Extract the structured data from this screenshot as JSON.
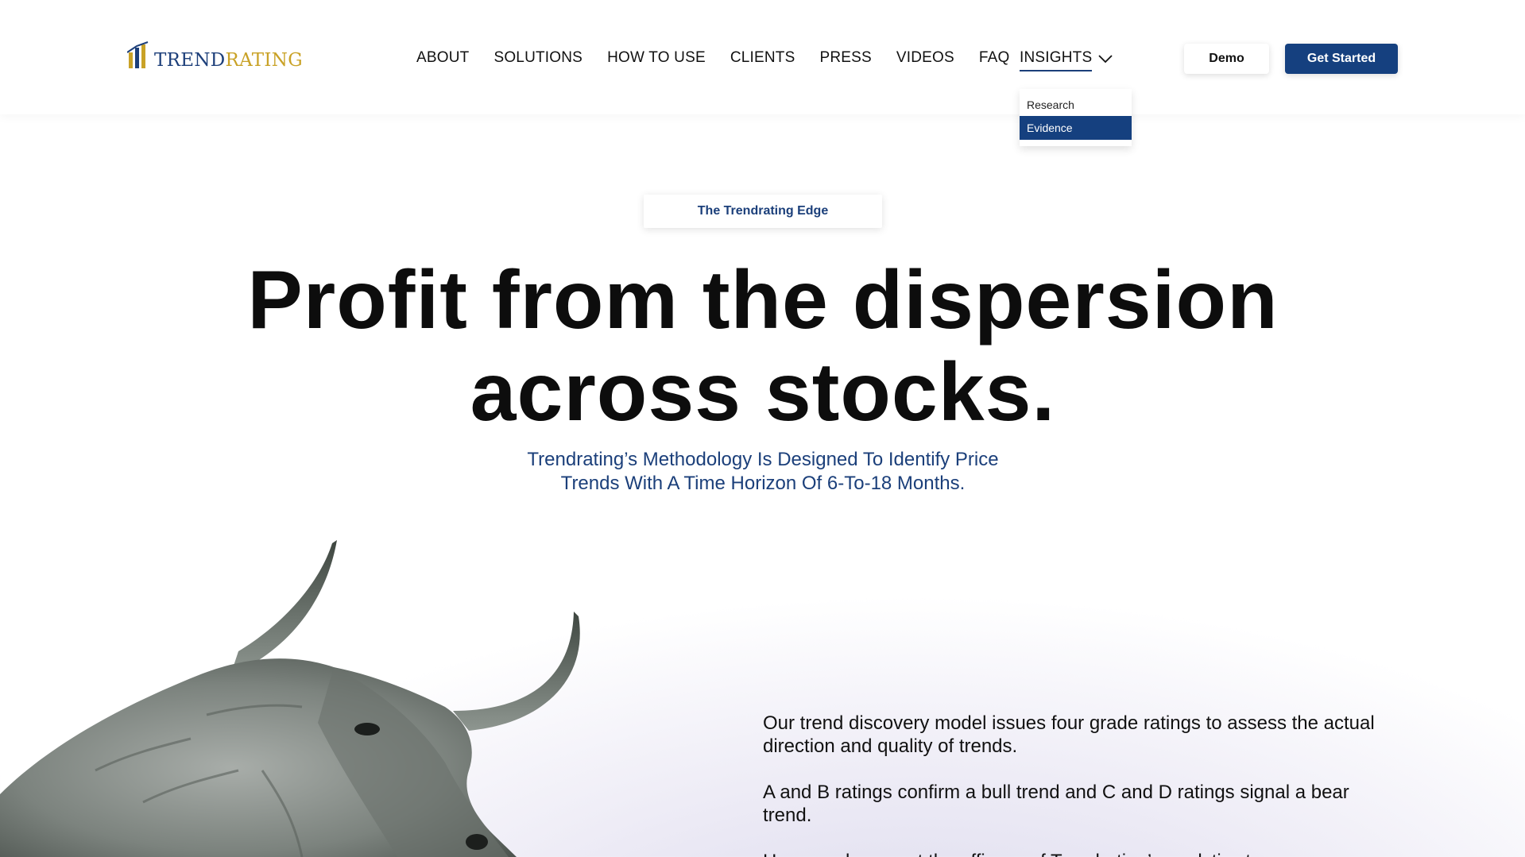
{
  "header": {
    "logo": {
      "trend": "TREND",
      "rating": "RATING"
    },
    "nav": [
      {
        "label": "ABOUT"
      },
      {
        "label": "SOLUTIONS"
      },
      {
        "label": "HOW TO USE"
      },
      {
        "label": "CLIENTS"
      },
      {
        "label": "PRESS"
      },
      {
        "label": "VIDEOS"
      },
      {
        "label": "FAQ"
      }
    ],
    "insights": {
      "label": "INSIGHTS",
      "icon": "chevron-down-icon"
    },
    "demo_label": "Demo",
    "get_started_label": "Get Started"
  },
  "dropdown": {
    "items": [
      {
        "label": "Research",
        "active": false
      },
      {
        "label": "Evidence",
        "active": true
      }
    ]
  },
  "hero": {
    "badge": "The Trendrating Edge",
    "headline_line1": "Profit from the dispersion",
    "headline_line2": "across stocks.",
    "subhead_line1": "Trendrating’s Methodology Is Designed To Identify Price",
    "subhead_line2": "Trends With A Time Horizon Of 6-To-18 Months."
  },
  "content": {
    "paragraphs": [
      "Our trend discovery model issues four grade ratings to assess the actual direction and quality of trends.",
      "A and B ratings confirm a bull trend and C and D ratings signal a bear trend.",
      "Here we document the efficacy of Trendrating’s analytics to"
    ]
  },
  "colors": {
    "brand_blue": "#15407f",
    "logo_gold": "#c9a227",
    "subhead_blue": "#1b3f7a"
  }
}
